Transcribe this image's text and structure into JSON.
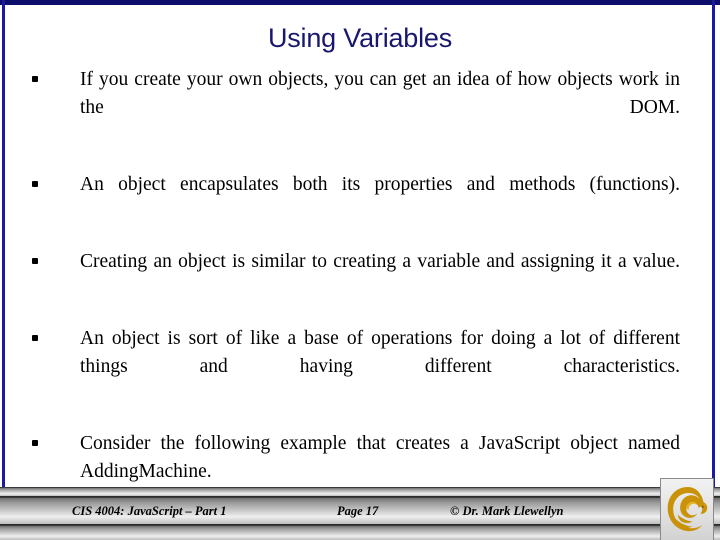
{
  "slide": {
    "title": "Using Variables",
    "title_color": "#17176e",
    "border_color": "#1a1aa0",
    "background_color": "#ffffff",
    "bullets": [
      {
        "marker": "bullet-dot",
        "text": "If you create your own objects, you can get an idea of how objects work in the DOM."
      },
      {
        "marker": "bullet-dot",
        "text": "An object encapsulates both its properties and methods (functions)."
      },
      {
        "marker": "bullet-dot",
        "text": "Creating an object is similar to creating a variable and assigning it a value."
      },
      {
        "marker": "bullet-dot",
        "text": "An object is sort of like a base of operations for doing a lot of different things and having different characteristics."
      },
      {
        "marker": "bullet-dot",
        "text": "Consider the following example that creates a JavaScript object named AddingMachine."
      }
    ]
  },
  "footer": {
    "course": "CIS 4004: JavaScript – Part 1",
    "page": "Page 17",
    "copyright": "© Dr. Mark Llewellyn",
    "logo": {
      "name": "ucf-pegasus-logo",
      "color": "#c99208",
      "highlight": "#e8b323"
    }
  }
}
